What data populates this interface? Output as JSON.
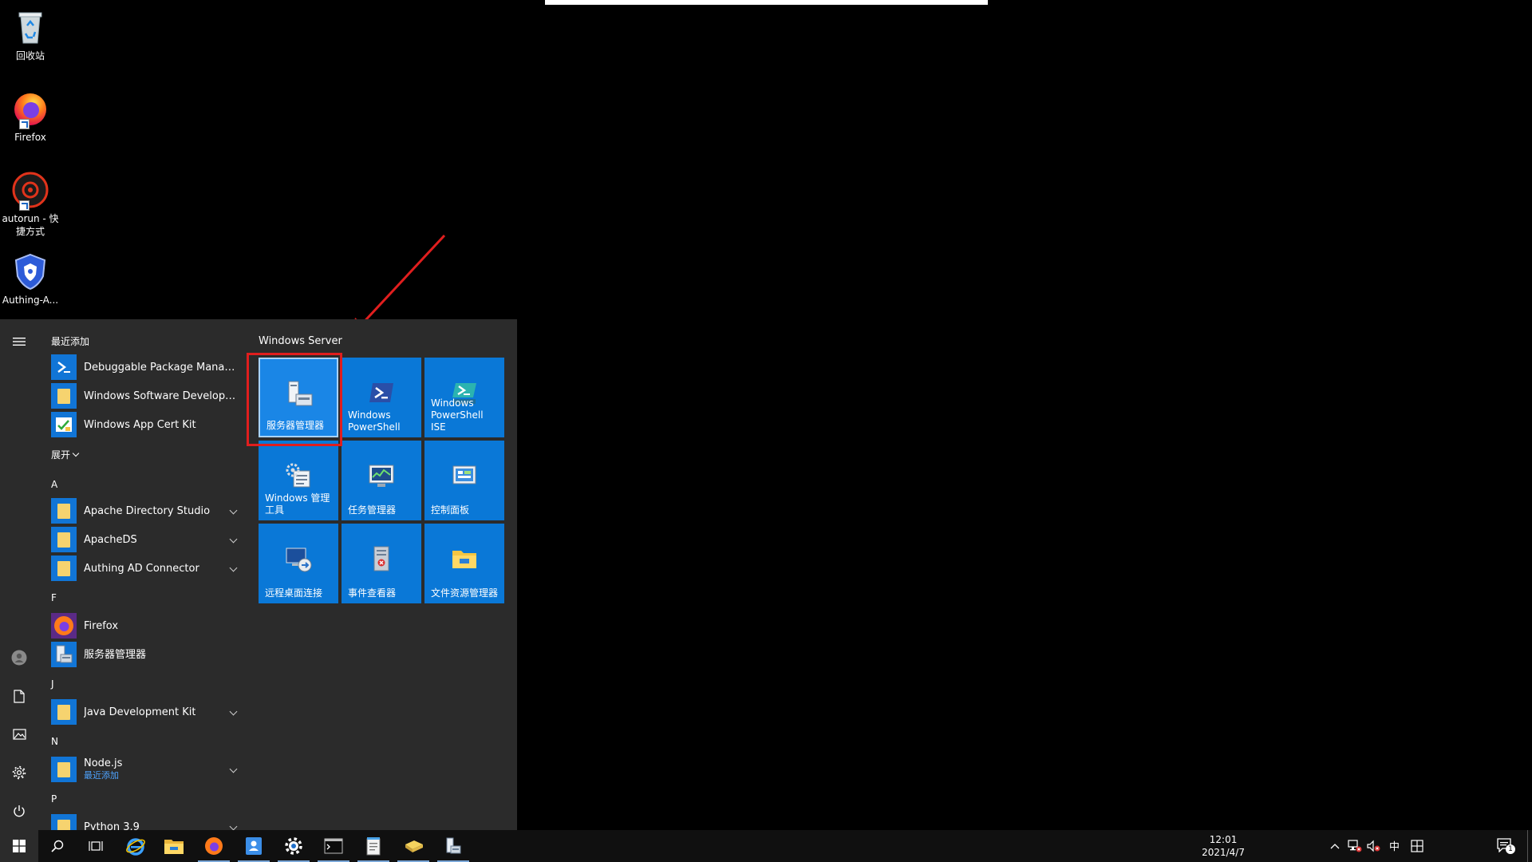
{
  "desktop": {
    "icons": [
      {
        "label": "回收站"
      },
      {
        "label": "Firefox"
      },
      {
        "label": "autorun - 快捷方式"
      },
      {
        "label": "Authing-A..."
      }
    ]
  },
  "start_menu": {
    "recent_header": "最近添加",
    "recent_apps": [
      {
        "name": "Debuggable Package Manager"
      },
      {
        "name": "Windows Software Development..."
      },
      {
        "name": "Windows App Cert Kit"
      }
    ],
    "expand_label": "展开",
    "sections": [
      {
        "letter": "A",
        "apps": [
          {
            "name": "Apache Directory Studio"
          },
          {
            "name": "ApacheDS"
          },
          {
            "name": "Authing AD Connector"
          }
        ]
      },
      {
        "letter": "F",
        "apps": [
          {
            "name": "Firefox"
          },
          {
            "name": "服务器管理器"
          }
        ]
      },
      {
        "letter": "J",
        "apps": [
          {
            "name": "Java Development Kit"
          }
        ]
      },
      {
        "letter": "N",
        "apps": [
          {
            "name": "Node.js",
            "sub": "最近添加"
          }
        ]
      },
      {
        "letter": "P",
        "apps": [
          {
            "name": "Python 3.9"
          }
        ]
      }
    ],
    "tile_group_title": "Windows Server",
    "tiles": [
      {
        "label": "服务器管理器"
      },
      {
        "label": "Windows PowerShell"
      },
      {
        "label": "Windows PowerShell ISE"
      },
      {
        "label": "Windows 管理工具"
      },
      {
        "label": "任务管理器"
      },
      {
        "label": "控制面板"
      },
      {
        "label": "远程桌面连接"
      },
      {
        "label": "事件查看器"
      },
      {
        "label": "文件资源管理器"
      }
    ]
  },
  "taskbar": {
    "tray_lang": "中",
    "clock_time": "12:01",
    "clock_date": "2021/4/7",
    "notification_count": "1"
  },
  "colors": {
    "tile_blue": "#0a78d7",
    "menu_bg": "#2b2b2b",
    "highlight_red": "#e01e1e"
  }
}
